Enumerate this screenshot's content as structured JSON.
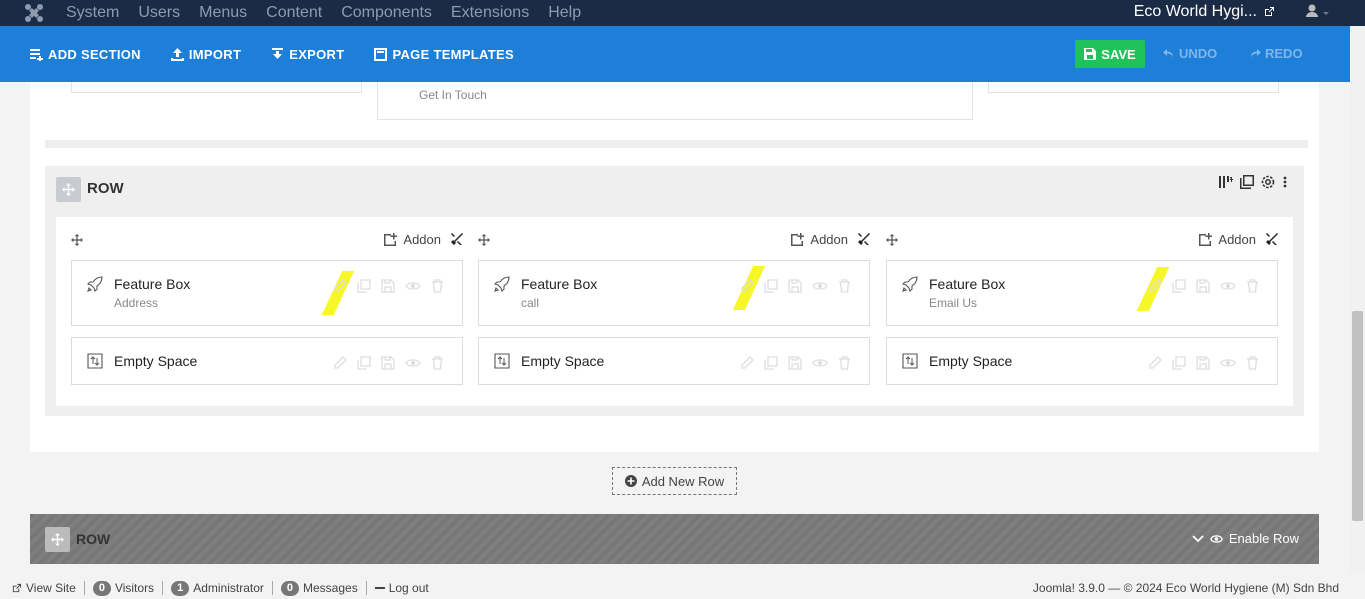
{
  "topnav": {
    "menu": [
      "System",
      "Users",
      "Menus",
      "Content",
      "Components",
      "Extensions",
      "Help"
    ],
    "site_name": "Eco World Hygi...",
    "icons": {
      "logo": "joomla-logo-icon",
      "user": "user-icon",
      "external": "external-link-icon"
    }
  },
  "toolbar": {
    "add_section": "ADD SECTION",
    "import": "IMPORT",
    "export": "EXPORT",
    "page_templates": "PAGE TEMPLATES",
    "save": "SAVE",
    "undo": "UNDO",
    "redo": "REDO"
  },
  "prev_row": {
    "middle_sub": "Get In Touch"
  },
  "row": {
    "label": "ROW",
    "columns": [
      {
        "add_label": "Addon",
        "addons": [
          {
            "title": "Feature Box",
            "sub": "Address"
          },
          {
            "title": "Empty Space",
            "sub": ""
          }
        ]
      },
      {
        "add_label": "Addon",
        "addons": [
          {
            "title": "Feature Box",
            "sub": "call"
          },
          {
            "title": "Empty Space",
            "sub": ""
          }
        ]
      },
      {
        "add_label": "Addon",
        "addons": [
          {
            "title": "Feature Box",
            "sub": "Email Us"
          },
          {
            "title": "Empty Space",
            "sub": ""
          }
        ]
      }
    ]
  },
  "add_new_row": "Add New Row",
  "row2": {
    "label": "ROW",
    "enable": "Enable Row"
  },
  "status": {
    "view_site": "View Site",
    "visitors_count": "0",
    "visitors": "Visitors",
    "admin_count": "1",
    "admin": "Administrator",
    "messages_count": "0",
    "messages": "Messages",
    "logout": "Log out",
    "footer": "Joomla! 3.9.0  —  © 2024 Eco World Hygiene (M) Sdn Bhd"
  },
  "colors": {
    "topnav": "#1c2b45",
    "toolbar": "#1e7fd9",
    "save": "#20c35a",
    "highlight": "#f7f71b"
  }
}
